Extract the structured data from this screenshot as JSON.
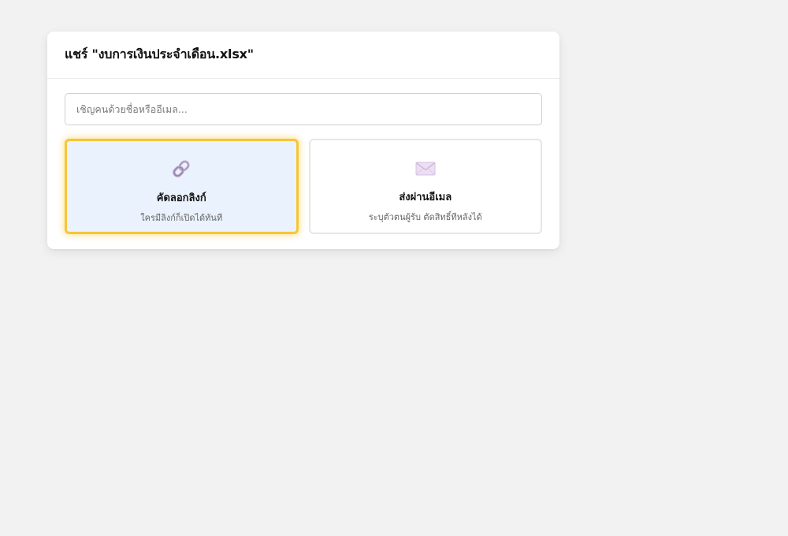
{
  "dialog": {
    "title": "แชร์ \"งบการเงินประจำเดือน.xlsx\"",
    "invite_input": {
      "value": "",
      "placeholder": "เชิญคนด้วยชื่อหรืออีเมล..."
    },
    "options": [
      {
        "icon": "link-icon",
        "title": "คัดลอกลิงก์",
        "description": "ใครมีลิงก์ก็เปิดได้ทันที",
        "selected": true
      },
      {
        "icon": "envelope-icon",
        "title": "ส่งผ่านอีเมล",
        "description": "ระบุตัวตนผู้รับ ตัดสิทธิ์ทีหลังได้",
        "selected": false
      }
    ]
  },
  "colors": {
    "page_background": "#f2f2f2",
    "dialog_background": "#ffffff",
    "selected_card_background": "#eaf2fd",
    "selected_card_border": "#f7c536",
    "card_border": "#e6e6e6"
  }
}
